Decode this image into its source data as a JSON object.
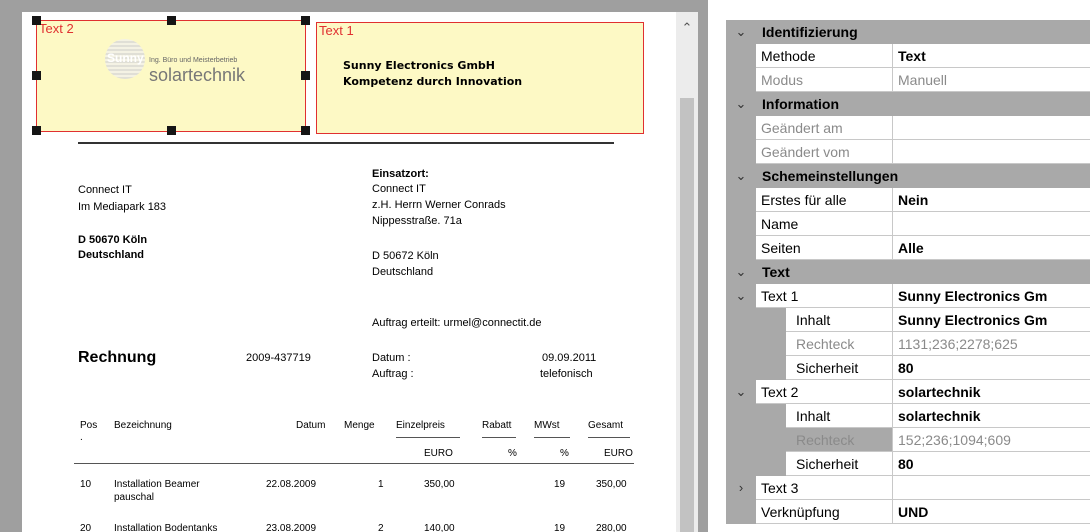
{
  "document": {
    "zones": [
      {
        "label": "Text 2"
      },
      {
        "label": "Text 1"
      }
    ],
    "logo": {
      "circle_text": "Sunny",
      "tagline": "Ing. Büro und Meisterbetrieb",
      "name": "solartechnik"
    },
    "company": {
      "line1": "Sunny Electronics GmbH",
      "line2": "Kompetenz durch Innovation"
    },
    "recipient": {
      "line1": "Connect IT",
      "line2": "Im Mediapark 183",
      "line3": "D 50670 Köln",
      "line4": "Deutschland"
    },
    "einsatzort": {
      "heading": "Einsatzort:",
      "line1": "Connect IT",
      "line2": "z.H. Herrn Werner Conrads",
      "line3": "Nippesstraße. 71a",
      "line4": "D 50672 Köln",
      "line5": "Deutschland"
    },
    "auftrag_erteilt": "Auftrag erteilt: urmel@connectit.de",
    "invoice": {
      "title": "Rechnung",
      "number": "2009-437719",
      "datum_label": "Datum :",
      "datum_value": "09.09.2011",
      "auftrag_label": "Auftrag :",
      "auftrag_value": "telefonisch"
    },
    "table": {
      "headers": {
        "pos": "Pos",
        "pos_dot": ".",
        "bezeichnung": "Bezeichnung",
        "datum": "Datum",
        "menge": "Menge",
        "einzelpreis": "Einzelpreis",
        "rabatt": "Rabatt",
        "mwst": "MWst",
        "gesamt": "Gesamt"
      },
      "units": {
        "einzelpreis": "EURO",
        "rabatt": "%",
        "mwst": "%",
        "gesamt": "EURO"
      },
      "rows": [
        {
          "pos": "10",
          "bez1": "Installation Beamer",
          "bez2": "pauschal",
          "datum": "22.08.2009",
          "menge": "1",
          "einzel": "350,00",
          "mwst": "19",
          "gesamt": "350,00"
        },
        {
          "pos": "20",
          "bez1": "Installation Bodentanks",
          "bez2": "",
          "datum": "23.08.2009",
          "menge": "2",
          "einzel": "140,00",
          "mwst": "19",
          "gesamt": "280,00"
        }
      ]
    }
  },
  "properties": {
    "sections": {
      "identifizierung": "Identifizierung",
      "information": "Information",
      "schemeinstellungen": "Schemeinstellungen",
      "text": "Text"
    },
    "methode": {
      "name": "Methode",
      "value": "Text"
    },
    "modus": {
      "name": "Modus",
      "value": "Manuell"
    },
    "geaendert_am": {
      "name": "Geändert am",
      "value": ""
    },
    "geaendert_vom": {
      "name": "Geändert vom",
      "value": ""
    },
    "erstes_fuer_alle": {
      "name": "Erstes für alle",
      "value": "Nein"
    },
    "name": {
      "name": "Name",
      "value": ""
    },
    "seiten": {
      "name": "Seiten",
      "value": "Alle"
    },
    "text1": {
      "name": "Text 1",
      "value": "Sunny Electronics Gm",
      "inhalt": {
        "name": "Inhalt",
        "value": "Sunny Electronics Gm"
      },
      "rechteck": {
        "name": "Rechteck",
        "value": "1131;236;2278;625"
      },
      "sicherheit": {
        "name": "Sicherheit",
        "value": "80"
      }
    },
    "text2": {
      "name": "Text 2",
      "value": "solartechnik",
      "inhalt": {
        "name": "Inhalt",
        "value": "solartechnik"
      },
      "rechteck": {
        "name": "Rechteck",
        "value": "152;236;1094;609"
      },
      "sicherheit": {
        "name": "Sicherheit",
        "value": "80"
      }
    },
    "text3": {
      "name": "Text 3",
      "value": ""
    },
    "verknuepfung": {
      "name": "Verknüpfung",
      "value": "UND"
    }
  }
}
